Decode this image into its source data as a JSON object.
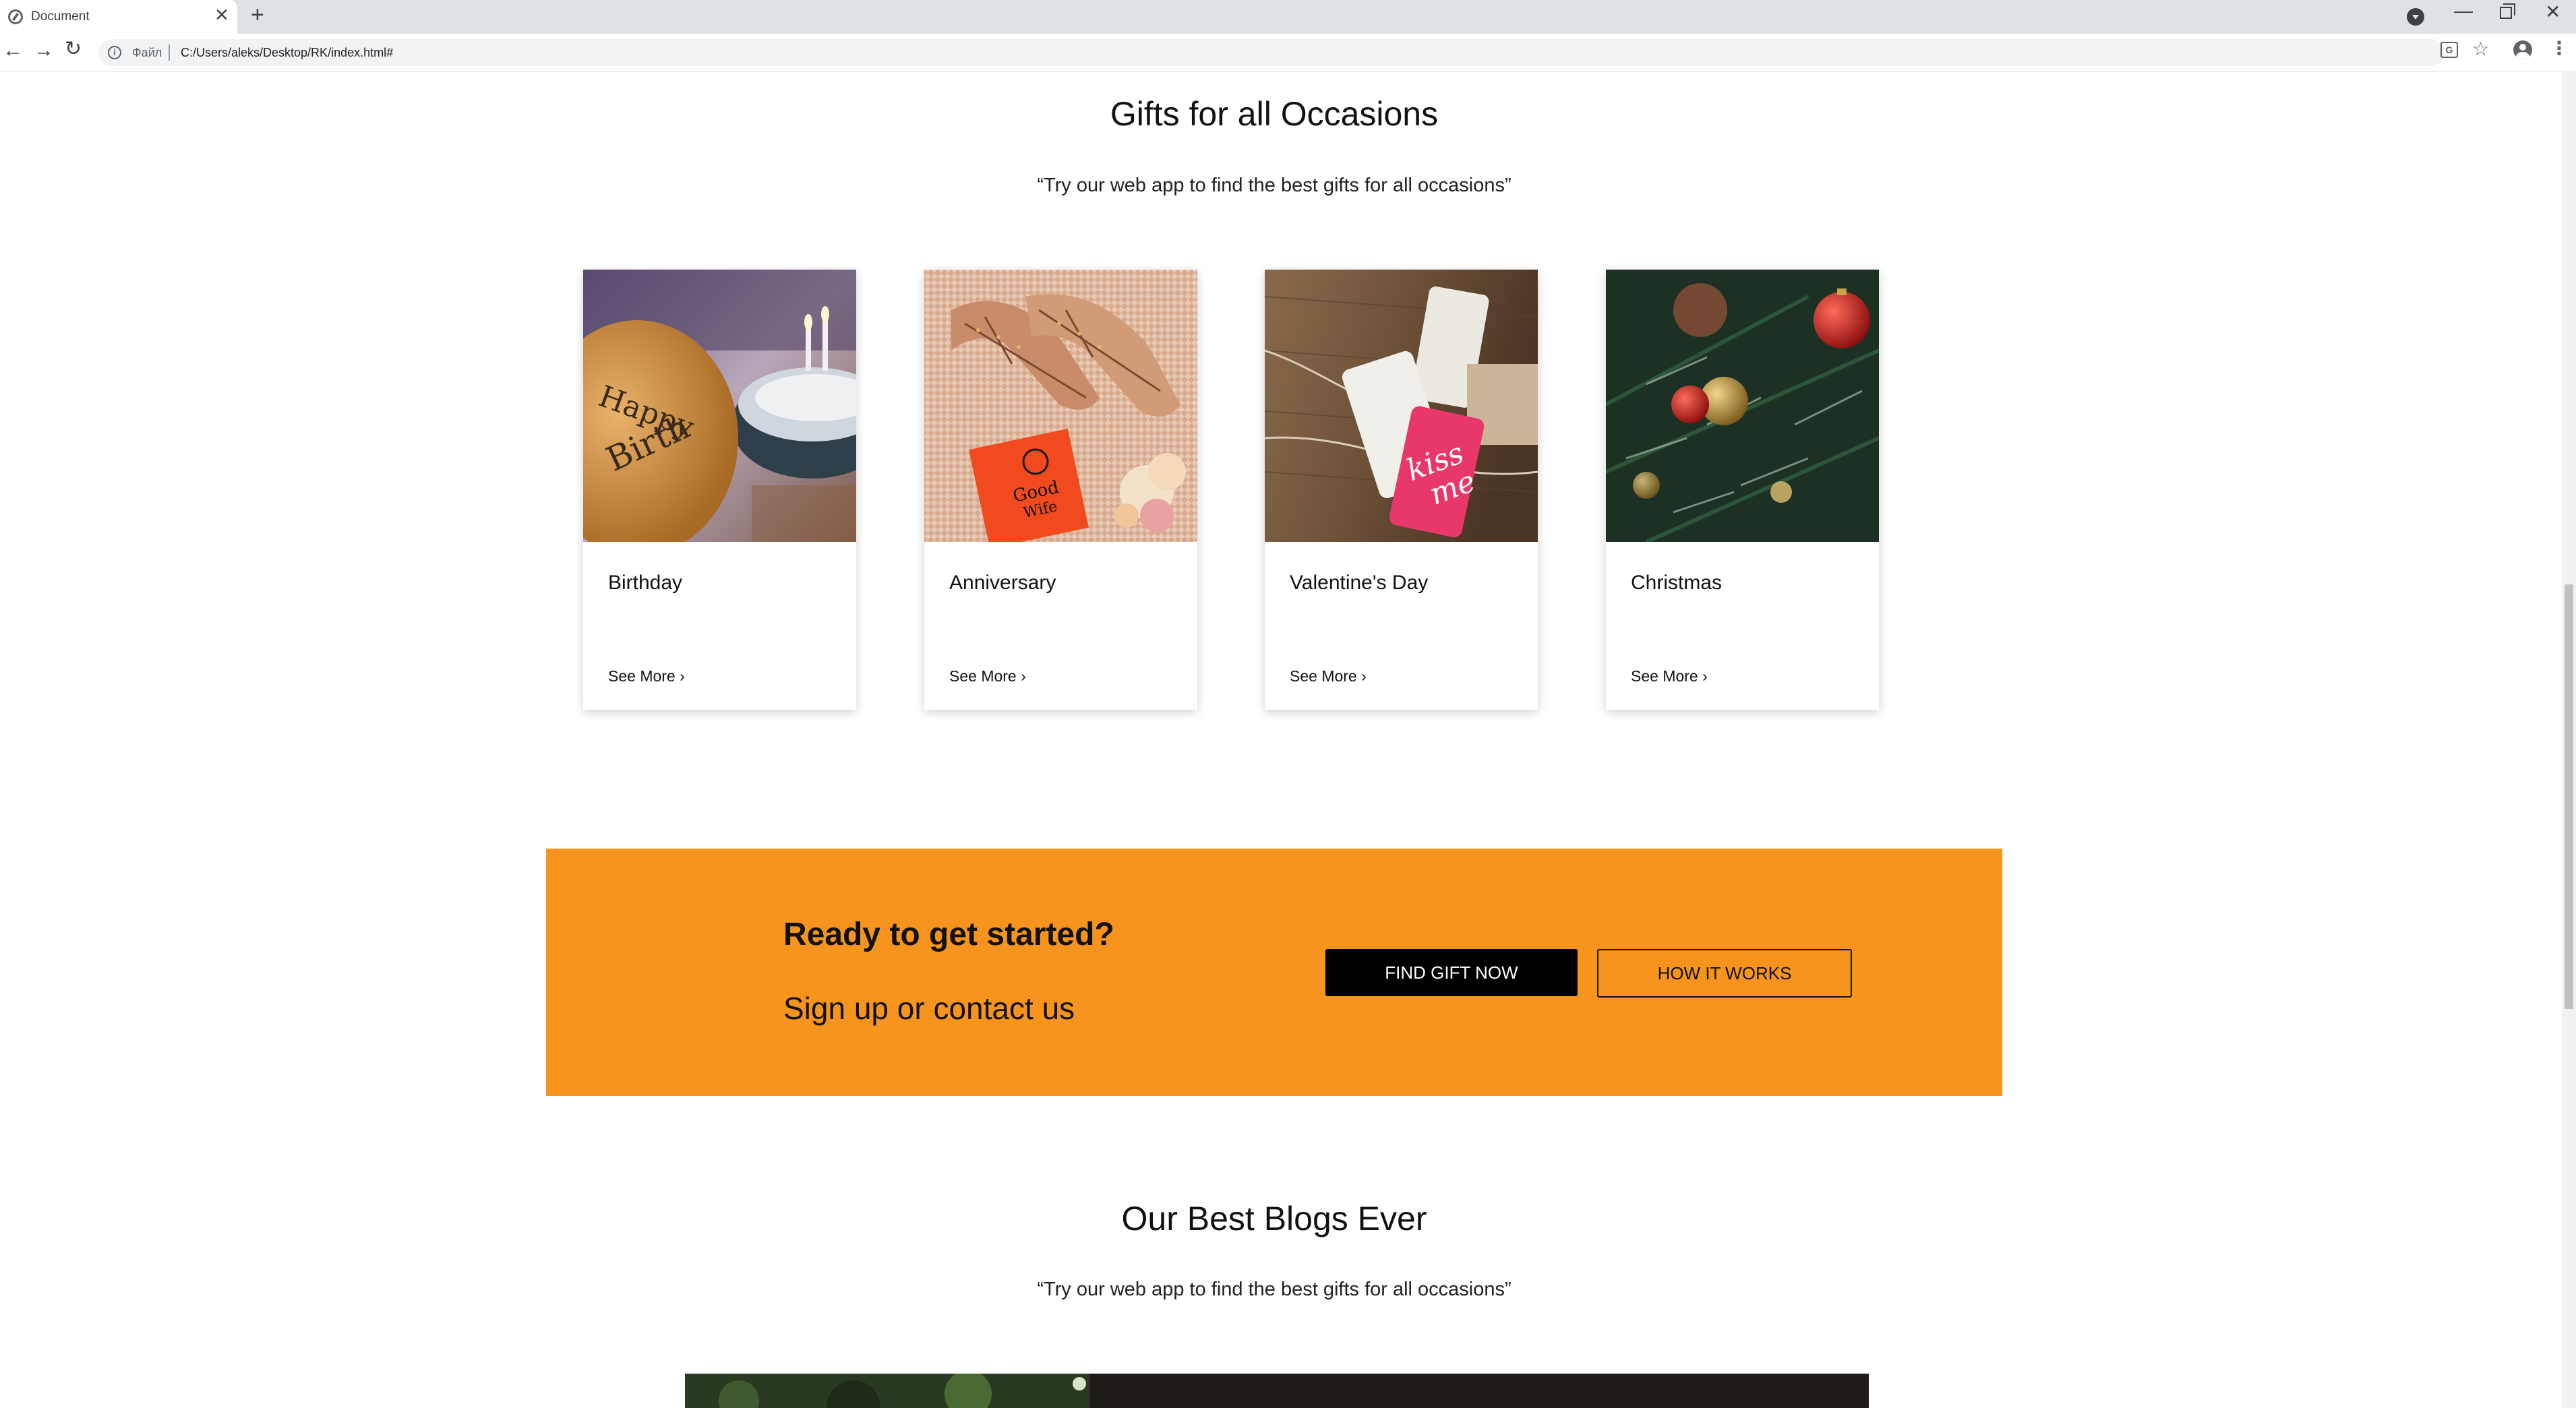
{
  "browser": {
    "tab_title": "Document",
    "tab_close": "✕",
    "new_tab": "+",
    "scheme_label": "Файл",
    "url": "C:/Users/aleks/Desktop/RK/index.html#",
    "minimize": "—",
    "close": "✕",
    "back": "←",
    "forward": "→",
    "reload": "↻",
    "info": "i",
    "translate": "G",
    "star": "☆",
    "menu": "⋮"
  },
  "occasions": {
    "title": "Gifts for all Occasions",
    "subtitle": "“Try our web app to find the best gifts for all occasions”",
    "cards": [
      {
        "title": "Birthday",
        "link": "See More ›",
        "image": "birthday-cake"
      },
      {
        "title": "Anniversary",
        "link": "See More ›",
        "image": "shoes-and-book"
      },
      {
        "title": "Valentine's Day",
        "link": "See More ›",
        "image": "gift-tags"
      },
      {
        "title": "Christmas",
        "link": "See More ›",
        "image": "christmas-tree"
      }
    ]
  },
  "cta": {
    "title": "Ready to get started?",
    "subtitle": "Sign up or contact us",
    "primary_button": "FIND GIFT NOW",
    "secondary_button": "HOW IT WORKS",
    "background_color": "#f7941d"
  },
  "blogs": {
    "title": "Our Best Blogs Ever",
    "subtitle": "“Try our web app to find the best gifts for all occasions”"
  },
  "image_text": {
    "birthday_balloon": "Happy Birthday",
    "book": "Good Wife",
    "tag": "kiss me"
  }
}
